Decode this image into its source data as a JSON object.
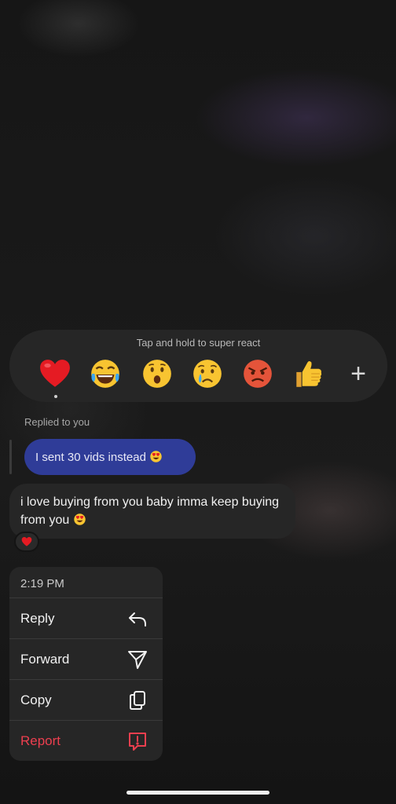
{
  "reactions": {
    "hint": "Tap and hold to super react",
    "items": [
      {
        "name": "heart-emoji",
        "selected": true
      },
      {
        "name": "tears-of-joy-emoji"
      },
      {
        "name": "surprised-emoji"
      },
      {
        "name": "crying-emoji"
      },
      {
        "name": "angry-emoji"
      },
      {
        "name": "thumbs-up-emoji"
      },
      {
        "name": "plus-icon"
      }
    ],
    "plus_symbol": "+"
  },
  "chat": {
    "replied_label": "Replied to you",
    "reply_text": "I sent 30 vids instead",
    "message_text": "i love buying from you baby imma keep buying from you",
    "reaction_badge": "heart-emoji"
  },
  "menu": {
    "time": "2:19 PM",
    "items": [
      {
        "label": "Reply",
        "icon": "reply-icon"
      },
      {
        "label": "Forward",
        "icon": "send-icon"
      },
      {
        "label": "Copy",
        "icon": "copy-icon"
      },
      {
        "label": "Report",
        "icon": "report-icon",
        "color": "#ed3f4f"
      }
    ]
  },
  "colors": {
    "reply_bubble": "#2f3c98",
    "bubble": "#262626",
    "danger": "#ed3f4f"
  }
}
